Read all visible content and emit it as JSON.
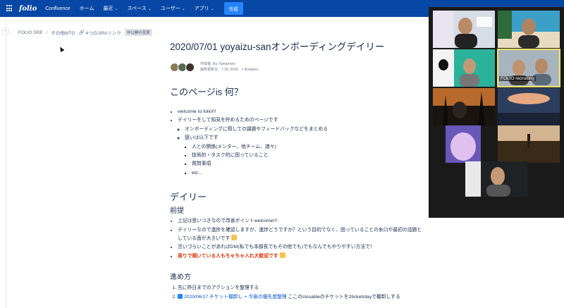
{
  "topnav": {
    "logo": "folio",
    "product": "Confluence",
    "items": [
      {
        "label": "ホーム",
        "chevron": false
      },
      {
        "label": "最近",
        "chevron": true
      },
      {
        "label": "スペース",
        "chevron": true
      },
      {
        "label": "ユーザー",
        "chevron": true
      },
      {
        "label": "アプリ",
        "chevron": true
      }
    ],
    "create_label": "作成",
    "brand_color": "#0747a6"
  },
  "breadcrumb": {
    "space": "FOLIO SRE",
    "parent": "その他MTG",
    "jira_links": "4つのJIRAリンク",
    "restriction_badge": "非公開の変更"
  },
  "page": {
    "title": "2020/07/01 yoyaizu-sanオンボーディングデイリー",
    "author_line": "作成者: Iku Yamamoto",
    "updated_line": "最終更新日：7 30, 2020",
    "analytics": "Analytics",
    "section1_heading": "このページis 何？",
    "section1_items": [
      "welcome to folio!!!",
      "デイリーをして知見を貯めるためのページです"
    ],
    "section1_sub": [
      "オンボーディングに際しての課題やフィードバックなどをまとめる",
      "狙いは以下です"
    ],
    "section1_subsub": [
      "人との関係(メンター、他チーム、諸々)",
      "技術的・タスク的に困っていること",
      "質問事項",
      "etc..."
    ],
    "section2_heading": "デイリー",
    "premise_heading": "前提",
    "premise_items": [
      "上記は思いつきなので改善ポイントwelcome!!!",
      "デイリーなので進捗を確認しますが、進捗どうですか？という目的でなく、困っていることの糸口や最初の話題としている面が大きいです",
      "言いづらいことがあればDM(私でも本部長でもその他でも)でもなんでもやりやすい方法で！",
      "周りで聞いている人もちゃちゃ入れ大歓迎です"
    ],
    "process_heading": "進め方",
    "process_steps": [
      "先に昨日までのアクションを整理する"
    ],
    "step2_link": "2020/06/17 チケット棚卸し + 今後の優先度整理",
    "step2_rest": "ここのclosableのチケットを2ticket/dayで棚卸しする"
  },
  "call": {
    "highlighted_label": "FOLIO recruiting",
    "tile_count": 9
  }
}
